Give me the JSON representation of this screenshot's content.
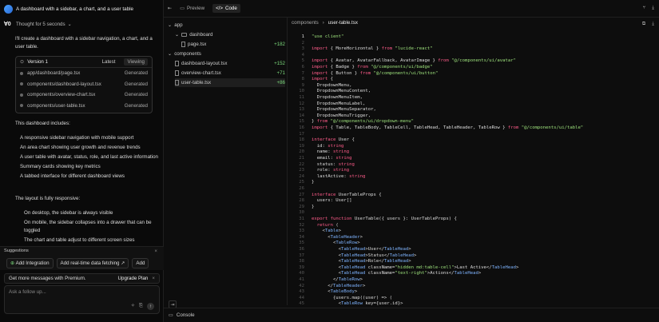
{
  "chat": {
    "title": "A dashboard with a sidebar, a chart, and a user table",
    "thought": "Thought for 5 seconds",
    "intro": "I'll create a dashboard with a sidebar navigation, a chart, and a user table.",
    "version": {
      "label": "Version 1",
      "latest": "Latest",
      "viewing": "Viewing",
      "files": [
        {
          "path": "app/dashboard/page.tsx",
          "status": "Generated"
        },
        {
          "path": "components/dashboard-layout.tsx",
          "status": "Generated"
        },
        {
          "path": "components/overview-chart.tsx",
          "status": "Generated"
        },
        {
          "path": "components/user-table.tsx",
          "status": "Generated"
        }
      ]
    },
    "includes_heading": "This dashboard includes:",
    "includes": [
      "A responsive sidebar navigation with mobile support",
      "An area chart showing user growth and revenue trends",
      "A user table with avatar, status, role, and last active information",
      "Summary cards showing key metrics",
      "A tabbed interface for different dashboard views"
    ],
    "layout_heading": "The layout is fully responsive:",
    "layout_items": [
      "On desktop, the sidebar is always visible",
      "On mobile, the sidebar collapses into a drawer that can be toggled",
      "The chart and table adjust to different screen sizes"
    ],
    "suggestions": {
      "heading": "Suggestions",
      "items": [
        "Add Integration",
        "Add real-time data fetching",
        "Add"
      ]
    },
    "premium": {
      "text": "Get more messages with Premium.",
      "button": "Upgrade Plan"
    },
    "input": {
      "placeholder": "Ask a follow up..."
    }
  },
  "panel": {
    "tabs": {
      "preview": "Preview",
      "code": "Code"
    },
    "tree": [
      {
        "label": "app",
        "indent": 0,
        "kind": "folder",
        "plus": ""
      },
      {
        "label": "dashboard",
        "indent": 1,
        "kind": "folder",
        "plus": ""
      },
      {
        "label": "page.tsx",
        "indent": 2,
        "kind": "file",
        "plus": "+182"
      },
      {
        "label": "components",
        "indent": 0,
        "kind": "folder",
        "plus": ""
      },
      {
        "label": "dashboard-layout.tsx",
        "indent": 1,
        "kind": "file",
        "plus": "+152"
      },
      {
        "label": "overview-chart.tsx",
        "indent": 1,
        "kind": "file",
        "plus": "+71"
      },
      {
        "label": "user-table.tsx",
        "indent": 1,
        "kind": "file",
        "plus": "+86"
      }
    ],
    "breadcrumb": {
      "folder": "components",
      "file": "user-table.tsx"
    },
    "console": "Console",
    "current_line": 1
  },
  "code_lines": [
    "\"use client\"",
    "",
    "import { MoreHorizontal } from \"lucide-react\"",
    "",
    "import { Avatar, AvatarFallback, AvatarImage } from \"@/components/ui/avatar\"",
    "import { Badge } from \"@/components/ui/badge\"",
    "import { Button } from \"@/components/ui/button\"",
    "import {",
    "  DropdownMenu,",
    "  DropdownMenuContent,",
    "  DropdownMenuItem,",
    "  DropdownMenuLabel,",
    "  DropdownMenuSeparator,",
    "  DropdownMenuTrigger,",
    "} from \"@/components/ui/dropdown-menu\"",
    "import { Table, TableBody, TableCell, TableHead, TableHeader, TableRow } from \"@/components/ui/table\"",
    "",
    "interface User {",
    "  id: string",
    "  name: string",
    "  email: string",
    "  status: string",
    "  role: string",
    "  lastActive: string",
    "}",
    "",
    "interface UserTableProps {",
    "  users: User[]",
    "}",
    "",
    "export function UserTable({ users }: UserTableProps) {",
    "  return (",
    "    <Table>",
    "      <TableHeader>",
    "        <TableRow>",
    "          <TableHead>User</TableHead>",
    "          <TableHead>Status</TableHead>",
    "          <TableHead>Role</TableHead>",
    "          <TableHead className=\"hidden md:table-cell\">Last Active</TableHead>",
    "          <TableHead className=\"text-right\">Actions</TableHead>",
    "        </TableRow>",
    "      </TableHeader>",
    "      <TableBody>",
    "        {users.map((user) => (",
    "          <TableRow key={user.id}>"
  ]
}
